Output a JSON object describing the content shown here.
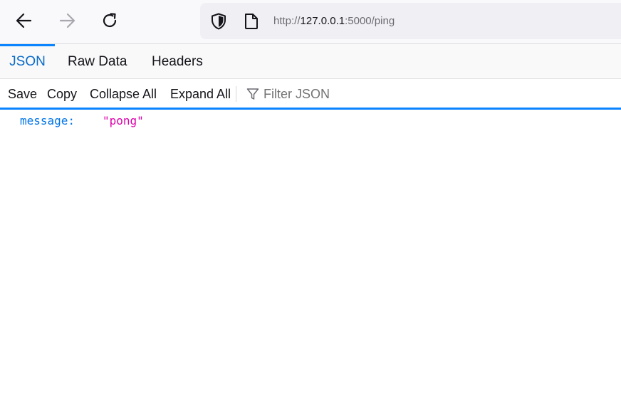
{
  "browser": {
    "url_prefix": "http://",
    "url_host": "127.0.0.1",
    "url_suffix": ":5000/ping"
  },
  "tabs": [
    {
      "label": "JSON",
      "selected": true
    },
    {
      "label": "Raw Data",
      "selected": false
    },
    {
      "label": "Headers",
      "selected": false
    }
  ],
  "toolbar": {
    "save": "Save",
    "copy": "Copy",
    "collapse_all": "Collapse All",
    "expand_all": "Expand All",
    "filter_placeholder": "Filter JSON"
  },
  "json_rows": [
    {
      "key": "message:",
      "value": "\"pong\""
    }
  ],
  "colors": {
    "accent": "#0a84ff",
    "key": "#0074e8",
    "string_value": "#dd00a9"
  },
  "icons": [
    "back-arrow-icon",
    "forward-arrow-icon",
    "reload-icon",
    "shield-icon",
    "page-icon",
    "filter-icon"
  ]
}
